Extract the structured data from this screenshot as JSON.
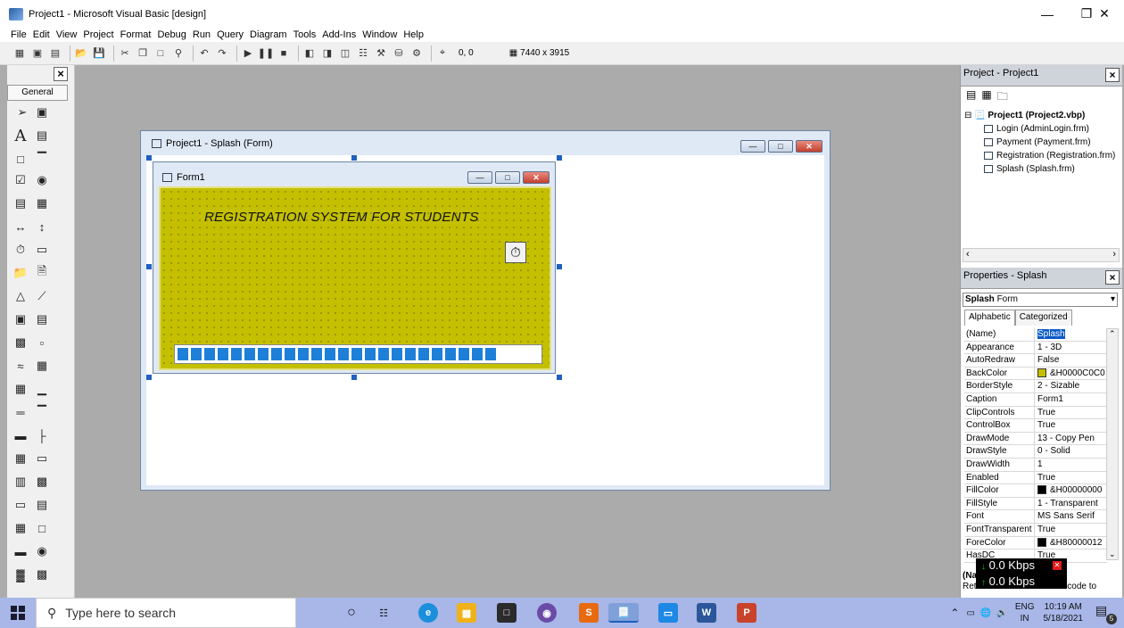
{
  "window": {
    "title": "Project1 - Microsoft Visual Basic [design]"
  },
  "menu": [
    "File",
    "Edit",
    "View",
    "Project",
    "Format",
    "Debug",
    "Run",
    "Query",
    "Diagram",
    "Tools",
    "Add-Ins",
    "Window",
    "Help"
  ],
  "toolbar": {
    "coords": "0, 0",
    "size": "7440 x 3915"
  },
  "toolbox": {
    "title": "General"
  },
  "splash_window": {
    "title": "Project1 - Splash (Form)"
  },
  "form1": {
    "title": "Form1",
    "label": "REGISTRATION SYSTEM FOR STUDENTS",
    "backcolor": "#c4c000",
    "progress_blocks": 24
  },
  "project_explorer": {
    "title": "Project - Project1",
    "root": "Project1 (Project2.vbp)",
    "items": [
      "Login (AdminLogin.frm)",
      "Payment (Payment.frm)",
      "Registration (Registration.frm)",
      "Splash (Splash.frm)"
    ]
  },
  "properties": {
    "title": "Properties - Splash",
    "object": "Splash",
    "object_type": "Form",
    "tabs": [
      "Alphabetic",
      "Categorized"
    ],
    "rows": [
      {
        "name": "(Name)",
        "value": "Splash"
      },
      {
        "name": "Appearance",
        "value": "1 - 3D"
      },
      {
        "name": "AutoRedraw",
        "value": "False"
      },
      {
        "name": "BackColor",
        "value": "&H0000C0C0",
        "swatch": "#c4c000"
      },
      {
        "name": "BorderStyle",
        "value": "2 - Sizable"
      },
      {
        "name": "Caption",
        "value": "Form1"
      },
      {
        "name": "ClipControls",
        "value": "True"
      },
      {
        "name": "ControlBox",
        "value": "True"
      },
      {
        "name": "DrawMode",
        "value": "13 - Copy Pen"
      },
      {
        "name": "DrawStyle",
        "value": "0 - Solid"
      },
      {
        "name": "DrawWidth",
        "value": "1"
      },
      {
        "name": "Enabled",
        "value": "True"
      },
      {
        "name": "FillColor",
        "value": "&H00000000",
        "swatch": "#000000"
      },
      {
        "name": "FillStyle",
        "value": "1 - Transparent"
      },
      {
        "name": "Font",
        "value": "MS Sans Serif"
      },
      {
        "name": "FontTransparent",
        "value": "True"
      },
      {
        "name": "ForeColor",
        "value": "&H80000012",
        "swatch": "#000000"
      },
      {
        "name": "HasDC",
        "value": "True"
      }
    ],
    "desc_title": "(Name)",
    "desc_text": "Returns the name used in code to"
  },
  "netmeter": {
    "down": "0.0 Kbps",
    "up": "0.0 Kbps"
  },
  "taskbar": {
    "search_placeholder": "Type here to search",
    "lang": "ENG",
    "region": "IN",
    "time": "10:19 AM",
    "date": "5/18/2021",
    "notif_count": "5"
  }
}
